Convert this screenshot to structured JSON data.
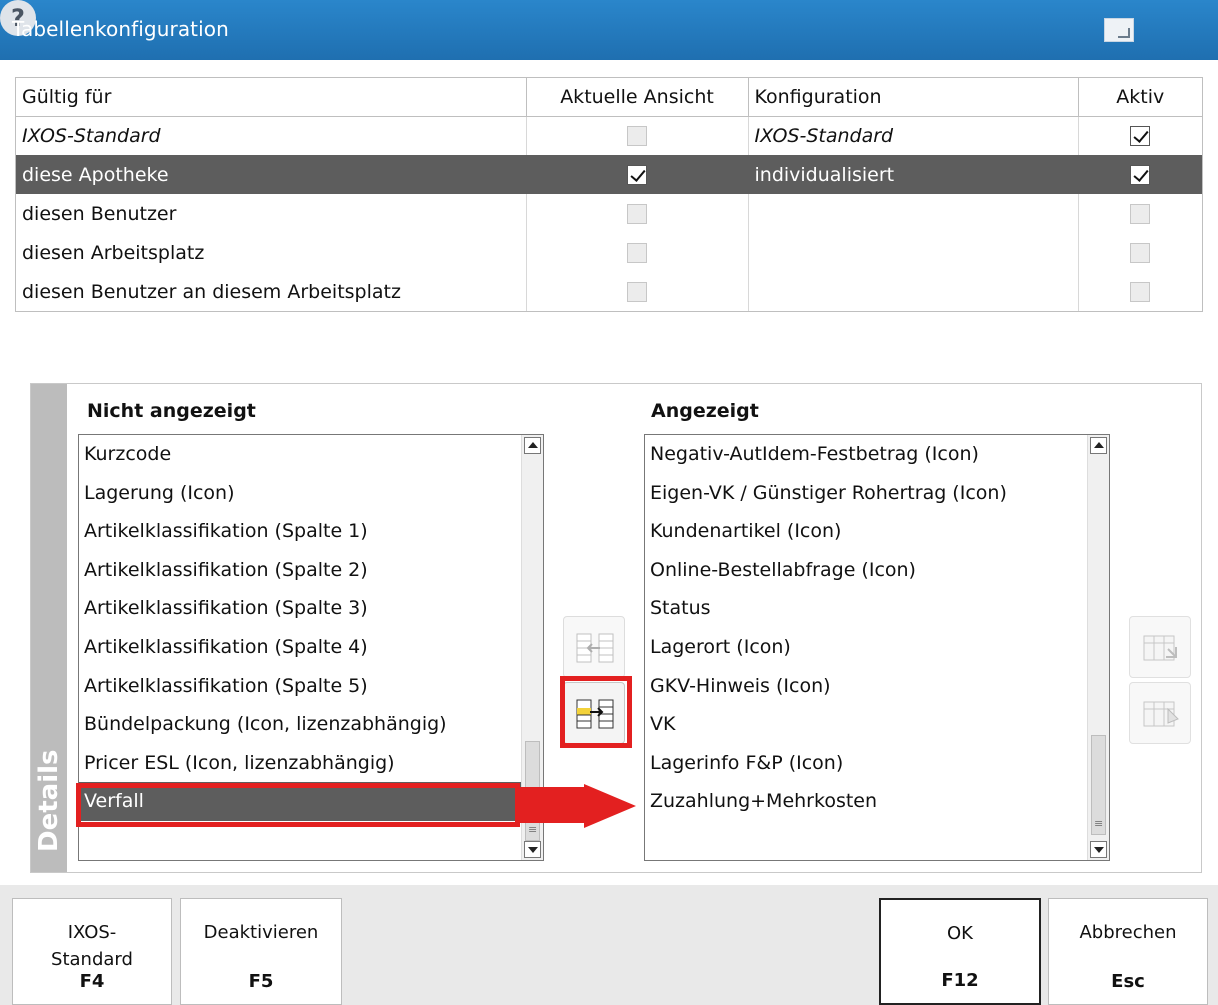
{
  "window": {
    "title": "Tabellenkonfiguration"
  },
  "grid": {
    "columns": [
      "Gültig für",
      "Aktuelle Ansicht",
      "Konfiguration",
      "Aktiv"
    ],
    "rows": [
      {
        "scope": "IXOS-Standard",
        "current_view": false,
        "config": "IXOS-Standard",
        "active": true,
        "italic": true,
        "selected": false
      },
      {
        "scope": "diese Apotheke",
        "current_view": true,
        "config": "individualisiert",
        "active": true,
        "italic": false,
        "selected": true
      },
      {
        "scope": "diesen Benutzer",
        "current_view": false,
        "config": "",
        "active": false,
        "italic": false,
        "selected": false
      },
      {
        "scope": "diesen Arbeitsplatz",
        "current_view": false,
        "config": "",
        "active": false,
        "italic": false,
        "selected": false
      },
      {
        "scope": "diesen Benutzer an diesem Arbeitsplatz",
        "current_view": false,
        "config": "",
        "active": false,
        "italic": false,
        "selected": false
      }
    ]
  },
  "details": {
    "tab_label": "Details",
    "not_shown": {
      "heading": "Nicht angezeigt",
      "items": [
        "Kurzcode",
        "Lagerung (Icon)",
        "Artikelklassifikation (Spalte 1)",
        "Artikelklassifikation (Spalte 2)",
        "Artikelklassifikation (Spalte 3)",
        "Artikelklassifikation (Spalte 4)",
        "Artikelklassifikation (Spalte 5)",
        "Bündelpackung (Icon, lizenzabhängig)",
        "Pricer ESL (Icon, lizenzabhängig)",
        "Verfall"
      ],
      "selected_index": 9
    },
    "shown": {
      "heading": "Angezeigt",
      "items": [
        "Negativ-AutIdem-Festbetrag (Icon)",
        "Eigen-VK / Günstiger Rohertrag (Icon)",
        "Kundenartikel (Icon)",
        "Online-Bestellabfrage (Icon)",
        "Status",
        "Lagerort (Icon)",
        "GKV-Hinweis (Icon)",
        "VK",
        "Lagerinfo F&P (Icon)",
        "Zuzahlung+Mehrkosten"
      ]
    }
  },
  "footer": {
    "buttons": [
      {
        "label": "IXOS-\nStandard",
        "key": "F4"
      },
      {
        "label": "Deaktivieren",
        "key": "F5"
      },
      {
        "label": "OK",
        "key": "F12"
      },
      {
        "label": "Abbrechen",
        "key": "Esc"
      }
    ]
  },
  "colors": {
    "titlebar": "#2a86cb",
    "selection": "#5d5d5d",
    "highlight": "#e32020"
  }
}
